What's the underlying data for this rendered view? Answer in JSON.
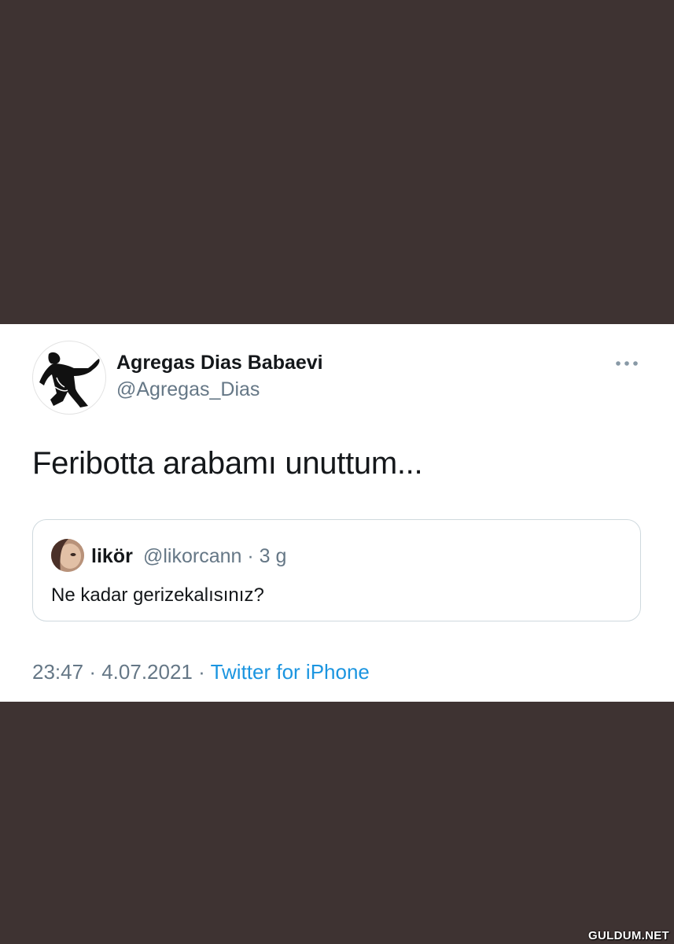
{
  "tweet": {
    "author_name": "Agregas Dias Babaevi",
    "author_handle": "@Agregas_Dias",
    "text": "Feribotta arabamı unuttum...",
    "more_icon": "more-dots-icon",
    "time": "23:47",
    "date": "4.07.2021",
    "source": "Twitter for iPhone",
    "separator": "·"
  },
  "quoted_tweet": {
    "author_name": "likör",
    "author_handle": "@likorcann",
    "age": "3 g",
    "text": "Ne kadar gerizekalısınız?"
  },
  "watermark": "GULDUM.NET",
  "colors": {
    "background": "#3e3332",
    "card": "#ffffff",
    "primary_text": "#14171a",
    "secondary_text": "#657786",
    "link": "#1b95e0",
    "border": "#cfd9de"
  }
}
